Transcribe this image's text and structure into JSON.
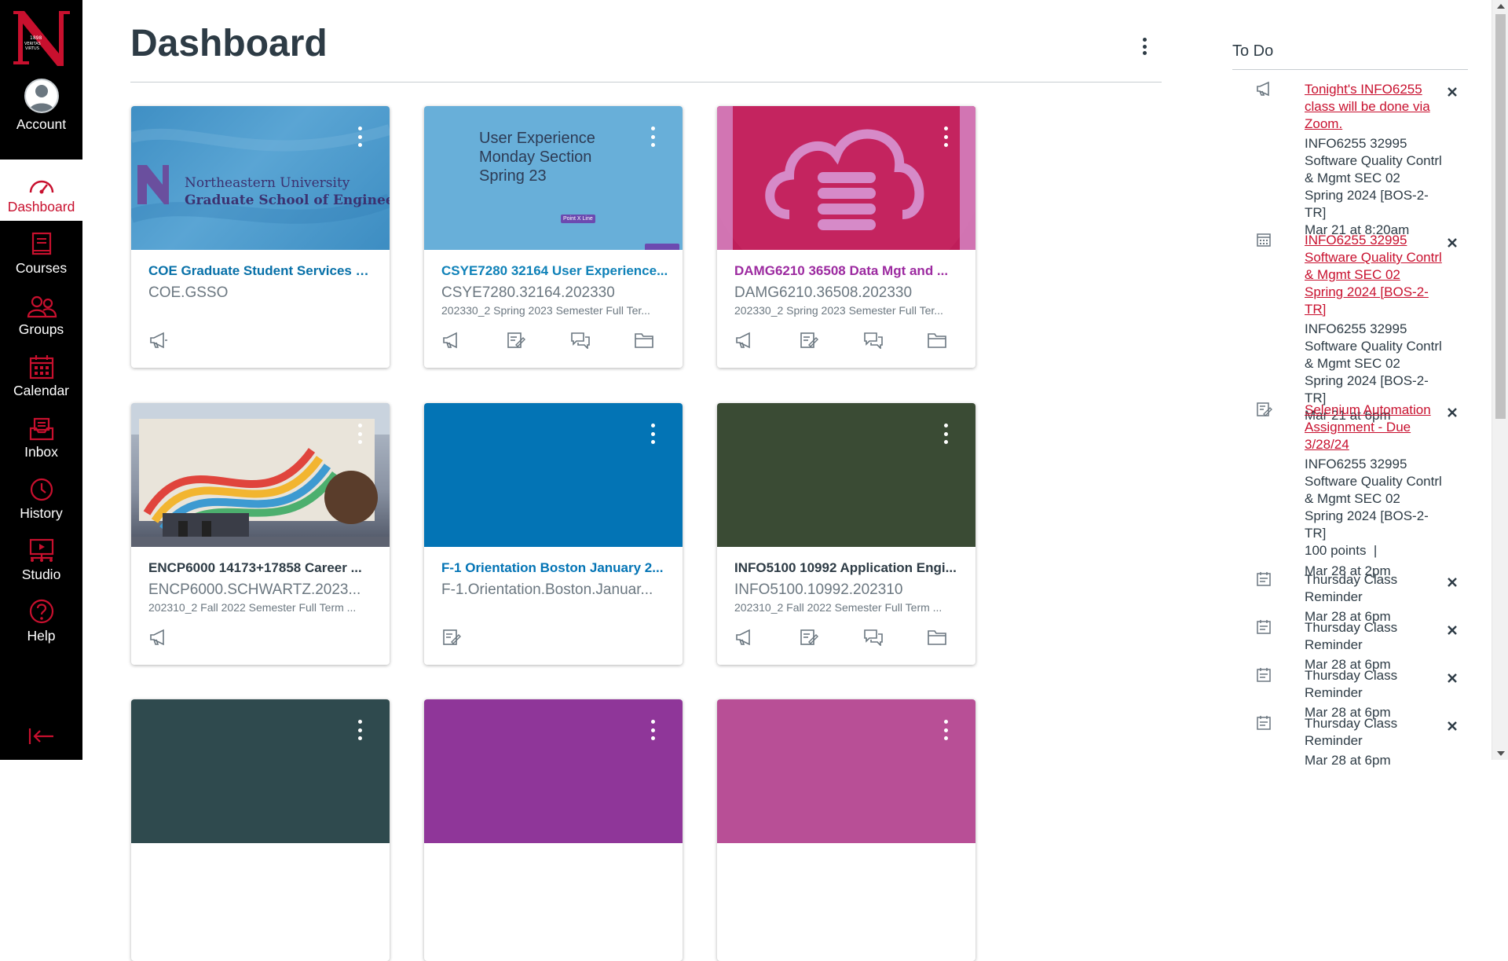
{
  "nav": {
    "items": [
      {
        "label": "Account",
        "icon": "avatar"
      },
      {
        "label": "Dashboard",
        "icon": "dashboard-icon"
      },
      {
        "label": "Courses",
        "icon": "courses-icon"
      },
      {
        "label": "Groups",
        "icon": "groups-icon"
      },
      {
        "label": "Calendar",
        "icon": "calendar-icon"
      },
      {
        "label": "Inbox",
        "icon": "inbox-icon"
      },
      {
        "label": "History",
        "icon": "history-icon"
      },
      {
        "label": "Studio",
        "icon": "studio-icon"
      },
      {
        "label": "Help",
        "icon": "help-icon"
      }
    ],
    "accent": "#c8102e"
  },
  "page": {
    "title": "Dashboard"
  },
  "cards": [
    {
      "title": "COE Graduate Student Services O...",
      "code": "COE.GSSO",
      "term": "",
      "color": "#4a90c2",
      "title_color": "#0770a8",
      "hero_text": [
        "Northeastern University",
        "Graduate School of Engineering"
      ]
    },
    {
      "title": "CSYE7280 32164 User Experience...",
      "code": "CSYE7280.32164.202330",
      "term": "202330_2 Spring 2023 Semester Full Ter...",
      "color": "#68afd9",
      "title_color": "#0e81b8",
      "hero_text": [
        "User Experience",
        "Monday Section",
        "Spring 23"
      ],
      "hero_tag": "Point X Line"
    },
    {
      "title": "DAMG6210 36508 Data Mgt and ...",
      "code": "DAMG6210.36508.202330",
      "term": "202330_2 Spring 2023 Semester Full Ter...",
      "color": "#bf1e5a",
      "title_color": "#9c2aa0"
    },
    {
      "title": "ENCP6000 14173+17858 Career ...",
      "code": "ENCP6000.SCHWARTZ.2023...",
      "term": "202310_2 Fall 2022 Semester Full Term ...",
      "color": "#7a7f88",
      "title_color": "#2d3b45"
    },
    {
      "title": "F-1 Orientation Boston January 2...",
      "code": "F-1.Orientation.Boston.Januar...",
      "term": "",
      "color": "#0374b5",
      "title_color": "#0374b5"
    },
    {
      "title": "INFO5100 10992 Application Engi...",
      "code": "INFO5100.10992.202310",
      "term": "202310_2 Fall 2022 Semester Full Term ...",
      "color": "#3a4b34",
      "title_color": "#2d3b45"
    },
    {
      "title": "",
      "code": "",
      "term": "",
      "color": "#2f4a4e",
      "title_color": "#2d3b45"
    },
    {
      "title": "",
      "code": "",
      "term": "",
      "color": "#8f3699",
      "title_color": "#2d3b45"
    },
    {
      "title": "",
      "code": "",
      "term": "",
      "color": "#b84f96",
      "title_color": "#2d3b45"
    }
  ],
  "todo": {
    "heading": "To Do",
    "items": [
      {
        "icon": "announcement-icon",
        "link": "Tonight's INFO6255 class will be done via Zoom.",
        "course": "INFO6255 32995 Software Quality Contrl & Mgmt SEC 02 Spring 2024 [BOS-2-TR]",
        "meta": "Mar 21 at 8:20am"
      },
      {
        "icon": "calendar-icon",
        "link": "INFO6255 32995 Software Quality Contrl & Mgmt SEC 02 Spring 2024 [BOS-2-TR]",
        "course": "INFO6255 32995 Software Quality Contrl & Mgmt SEC 02 Spring 2024 [BOS-2-TR]",
        "meta": "Mar 21 at 6pm"
      },
      {
        "icon": "assignment-icon",
        "link": "Selenium Automation Assignment - Due 3/28/24",
        "course": "INFO6255 32995 Software Quality Contrl & Mgmt SEC 02 Spring 2024 [BOS-2-TR]",
        "points": "100 points  |",
        "meta": "Mar 28 at 2pm"
      },
      {
        "icon": "note-icon",
        "text": "Thursday Class Reminder",
        "meta": "Mar 28 at 6pm"
      },
      {
        "icon": "note-icon",
        "text": "Thursday Class Reminder",
        "meta": "Mar 28 at 6pm"
      },
      {
        "icon": "note-icon",
        "text": "Thursday Class Reminder",
        "meta": "Mar 28 at 6pm"
      },
      {
        "icon": "note-icon",
        "text": "Thursday Class Reminder",
        "meta": "Mar 28 at 6pm"
      }
    ]
  }
}
